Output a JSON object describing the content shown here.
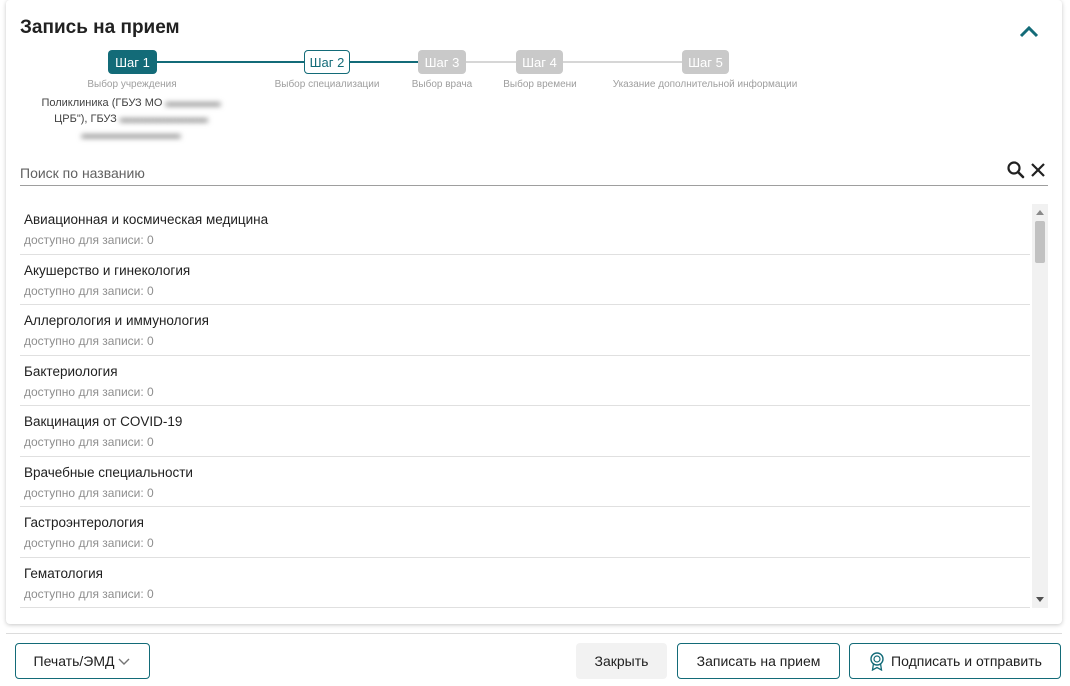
{
  "header": {
    "title": "Запись на прием"
  },
  "stepper": {
    "steps": [
      {
        "label": "Шаг 1",
        "caption": "Выбор учреждения"
      },
      {
        "label": "Шаг 2",
        "caption": "Выбор специализации"
      },
      {
        "label": "Шаг 3",
        "caption": "Выбор врача"
      },
      {
        "label": "Шаг 4",
        "caption": "Выбор времени"
      },
      {
        "label": "Шаг 5",
        "caption": "Указание дополнительной информации"
      }
    ],
    "selected_institution": {
      "line1": "Поликлиника (ГБУЗ МО",
      "line2": "ЦРБ\"), ГБУЗ"
    }
  },
  "search": {
    "placeholder": "Поиск по названию",
    "value": ""
  },
  "specializations": [
    {
      "name": "Авиационная и космическая медицина",
      "availability": "доступно для записи: 0"
    },
    {
      "name": "Акушерство и гинекология",
      "availability": "доступно для записи: 0"
    },
    {
      "name": "Аллергология и иммунология",
      "availability": "доступно для записи: 0"
    },
    {
      "name": "Бактериология",
      "availability": "доступно для записи: 0"
    },
    {
      "name": "Вакцинация от COVID-19",
      "availability": "доступно для записи: 0"
    },
    {
      "name": "Врачебные специальности",
      "availability": "доступно для записи: 0"
    },
    {
      "name": "Гастроэнтерология",
      "availability": "доступно для записи: 0"
    },
    {
      "name": "Гематология",
      "availability": "доступно для записи: 0"
    }
  ],
  "footer": {
    "print_label": "Печать/ЭМД",
    "close_label": "Закрыть",
    "book_label": "Записать на прием",
    "sign_label": "Подписать и отправить"
  },
  "colors": {
    "accent": "#136b78",
    "inactive_step": "#c9c9c9"
  },
  "icons": {
    "collapse": "chevron-up-icon",
    "search": "search-icon",
    "clear": "close-icon",
    "print_dropdown": "chevron-down-icon",
    "sign": "certificate-icon"
  }
}
